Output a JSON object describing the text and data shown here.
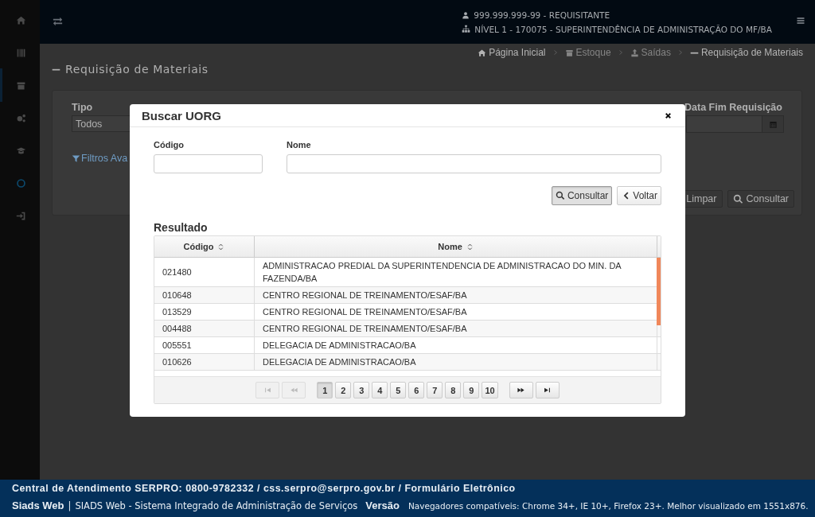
{
  "sidebar": {
    "items": [
      {
        "selected": false
      },
      {
        "selected": false
      },
      {
        "selected": true
      },
      {
        "selected": false
      },
      {
        "selected": false
      },
      {
        "selected": false
      },
      {
        "selected": false
      }
    ]
  },
  "header": {
    "user": "999.999.999-99 - REQUISITANTE",
    "unit": "NÍVEL 1 - 170075 - SUPERINTENDÊNCIA DE ADMINISTRAÇÃO DO MF/BA"
  },
  "breadcrumb": [
    {
      "label": "Página Inicial",
      "disabled": false
    },
    {
      "label": "Estoque",
      "disabled": true
    },
    {
      "label": "Saídas",
      "disabled": true
    },
    {
      "label": "Requisição de Materiais",
      "disabled": false
    }
  ],
  "page_title": "Requisição de Materiais",
  "filters": {
    "labels": [
      "Tipo",
      "Data Fim Requisição"
    ],
    "tipo_value": "Todos",
    "advanced_link": "Filtros Ava",
    "buttons": [
      {
        "label": "Limpar",
        "kind": "clear"
      },
      {
        "label": "Consultar",
        "kind": "search"
      }
    ]
  },
  "modal": {
    "title": "Buscar UORG",
    "fields": [
      {
        "label": "Código"
      },
      {
        "label": "Nome"
      }
    ],
    "buttons": [
      {
        "label": "Consultar",
        "kind": "search",
        "focused": true
      },
      {
        "label": "Voltar",
        "kind": "back",
        "focused": false
      }
    ],
    "result_title": "Resultado",
    "table": {
      "columns": [
        "Código",
        "Nome"
      ],
      "rows": [
        {
          "code": "021480",
          "name": "ADMINISTRACAO PREDIAL DA SUPERINTENDENCIA DE ADMINISTRACAO DO MIN. DA FAZENDA/BA"
        },
        {
          "code": "010648",
          "name": "CENTRO REGIONAL DE TREINAMENTO/ESAF/BA"
        },
        {
          "code": "013529",
          "name": "CENTRO REGIONAL DE TREINAMENTO/ESAF/BA"
        },
        {
          "code": "004488",
          "name": "CENTRO REGIONAL DE TREINAMENTO/ESAF/BA"
        },
        {
          "code": "005551",
          "name": "DELEGACIA DE ADMINISTRACAO/BA"
        },
        {
          "code": "010626",
          "name": "DELEGACIA DE ADMINISTRACAO/BA"
        }
      ]
    },
    "pager": {
      "first": {
        "disabled": true
      },
      "previous": {
        "disabled": true
      },
      "next": {
        "disabled": false
      },
      "last": {
        "disabled": false
      },
      "pages": [
        {
          "label": "1",
          "selected": true
        },
        {
          "label": "2",
          "selected": false
        },
        {
          "label": "3",
          "selected": false
        },
        {
          "label": "4",
          "selected": false
        },
        {
          "label": "5",
          "selected": false
        },
        {
          "label": "6",
          "selected": false
        },
        {
          "label": "7",
          "selected": false
        },
        {
          "label": "8",
          "selected": false
        },
        {
          "label": "9",
          "selected": false
        },
        {
          "label": "10",
          "selected": false
        }
      ]
    }
  },
  "footer": {
    "contact": "Central de Atendimento SERPRO: 0800-9782332 / css.serpro@serpro.gov.br / Formulário Eletrônico",
    "app_name": "Siads Web",
    "separator": "|",
    "app_full": "SIADS Web - Sistema Integrado de Administração de Serviços",
    "version_label": "Versão",
    "browsers": "Navegadores compatíveis: Chrome 34+, IE 10+, Firefox 23+. Melhor visualizado em 1551x876."
  }
}
